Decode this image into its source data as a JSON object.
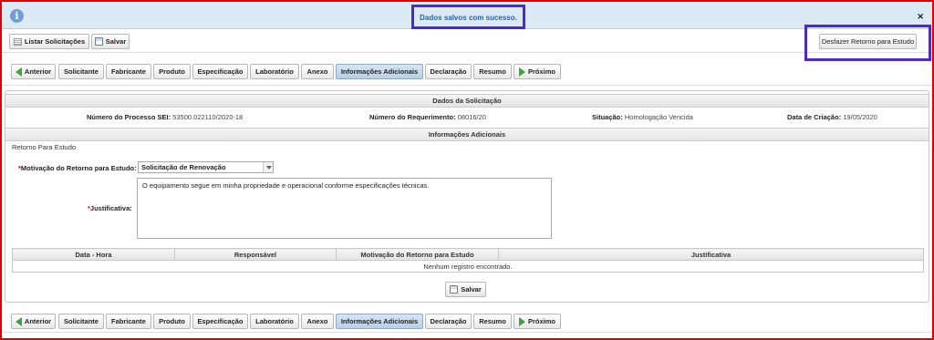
{
  "message": {
    "text": "Dados salvos com sucesso.",
    "info_icon": "info-icon",
    "close_symbol": "×"
  },
  "toolbar": {
    "list_label": "Listar Solicitações",
    "save_label": "Salvar",
    "undo_label": "Desfazer Retorno para Estudo"
  },
  "tabs": {
    "previous": "Anterior",
    "items": [
      "Solicitante",
      "Fabricante",
      "Produto",
      "Especificação",
      "Laboratório",
      "Anexo",
      "Informações Adicionais",
      "Declaração",
      "Resumo"
    ],
    "active": "Informações Adicionais",
    "next": "Próximo"
  },
  "solicitacao": {
    "header": "Dados da Solicitação",
    "processo_label": "Número do Processo SEI:",
    "processo_value": "53500.022110/2020-18",
    "requerimento_label": "Número do Requerimento:",
    "requerimento_value": "08016/20",
    "situacao_label": "Situação:",
    "situacao_value": "Homologação Vencida",
    "criacao_label": "Data de Criação:",
    "criacao_value": "19/05/2020"
  },
  "info": {
    "header": "Informações Adicionais",
    "subtitle": "Retorno Para Estudo",
    "required_mark": "*",
    "motivacao_label": "Motivação do Retorno para Estudo:",
    "motivacao_value": "Solicitação de Renovação",
    "justificativa_label": "Justificativa:",
    "justificativa_value": "O equipamento segue em minha propriedade e operacional conforme especificações técnicas.",
    "table": {
      "columns": [
        "Data - Hora",
        "Responsável",
        "Motivação do Retorno para Estudo",
        "Justificativa"
      ],
      "empty_text": "Nenhum registro encontrado."
    },
    "save_label": "Salvar"
  },
  "colors": {
    "frame": "#e00000",
    "highlight_box": "#4a2bd0",
    "message_bg": "#dceaf6",
    "message_text": "#1f63b8",
    "nav_arrow": "#3aa63a",
    "active_tab": "#b8cfe6"
  }
}
